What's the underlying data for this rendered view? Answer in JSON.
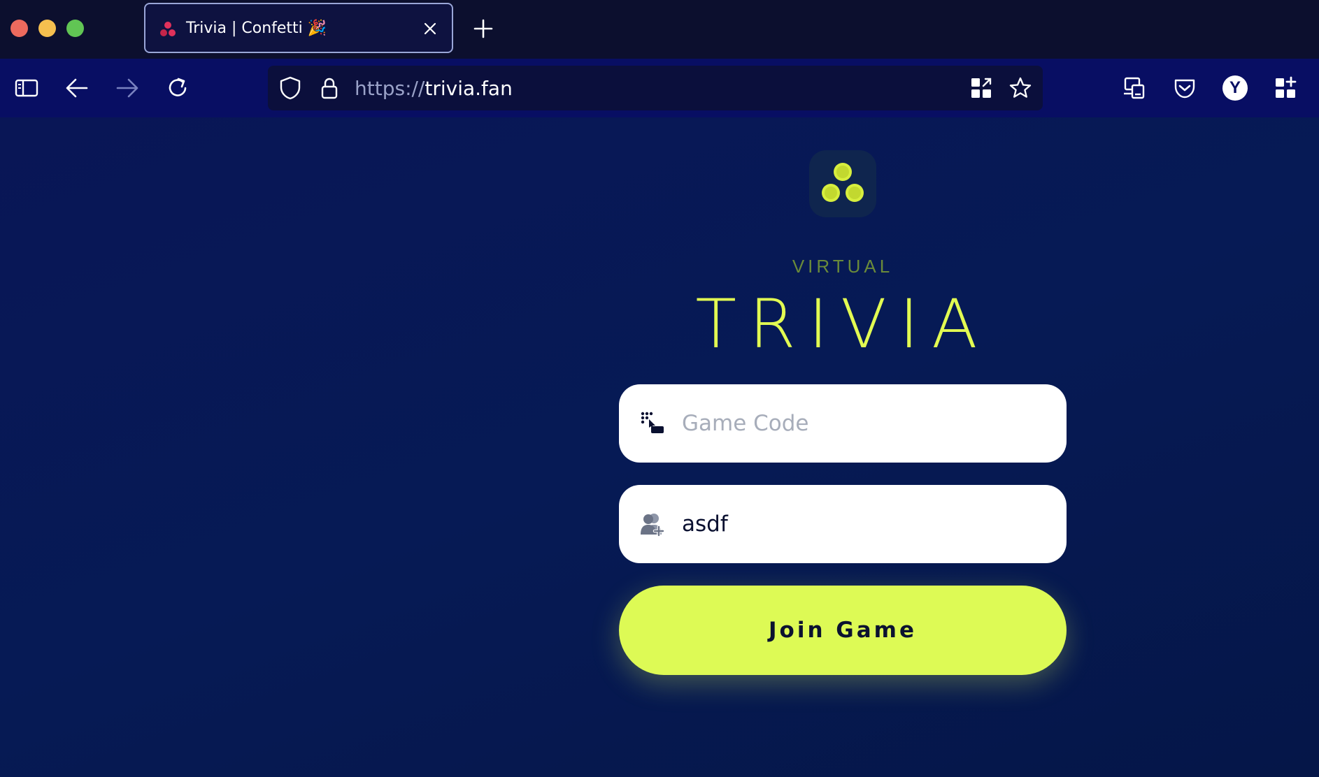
{
  "window": {
    "tab": {
      "title": "Trivia | Confetti 🎉",
      "favicon": "confetti-dots-icon"
    }
  },
  "toolbar": {
    "url_protocol": "https://",
    "url_host": "trivia.fan",
    "account_initial": "Y"
  },
  "page": {
    "subtitle": "VIRTUAL",
    "title": "TRIVIA",
    "game_code": {
      "placeholder": "Game Code",
      "value": ""
    },
    "player_name": {
      "placeholder": "",
      "value": "asdf"
    },
    "join_label": "Join Game"
  },
  "colors": {
    "accent": "#ddfa55",
    "background": "#061a55",
    "toolbar": "#080e63",
    "titlebar": "#0c0f2e"
  }
}
